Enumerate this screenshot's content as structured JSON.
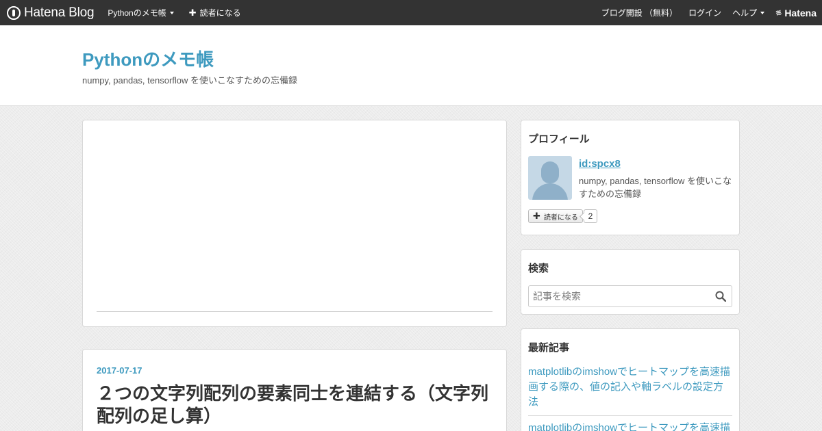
{
  "topbar": {
    "brand": "Hatena Blog",
    "blog_menu": "Pythonのメモ帳",
    "subscribe": "読者になる",
    "open_blog": "ブログ開設 （無料）",
    "login": "ログイン",
    "help": "ヘルプ",
    "hatena": "Hatena"
  },
  "header": {
    "title": "Pythonのメモ帳",
    "description": "numpy, pandas, tensorflow を使いこなすための忘備録"
  },
  "entry": {
    "date": "2017-07-17",
    "title": "２つの文字列配列の要素同士を連結する（文字列配列の足し算）"
  },
  "sidebar": {
    "profile": {
      "heading": "プロフィール",
      "id": "id:spcx8",
      "description": "numpy, pandas, tensorflow を使いこなすための忘備録",
      "subscribe_label": "読者になる",
      "subscriber_count": "2"
    },
    "search": {
      "heading": "検索",
      "placeholder": "記事を検索"
    },
    "recent": {
      "heading": "最新記事",
      "items": [
        "matplotlibのimshowでヒートマップを高速描画する際の、値の記入や軸ラベルの設定方法",
        "matplotlibのimshowでヒートマップを高速描"
      ]
    }
  },
  "colors": {
    "accent": "#3e9abf",
    "topbar": "#333333"
  }
}
